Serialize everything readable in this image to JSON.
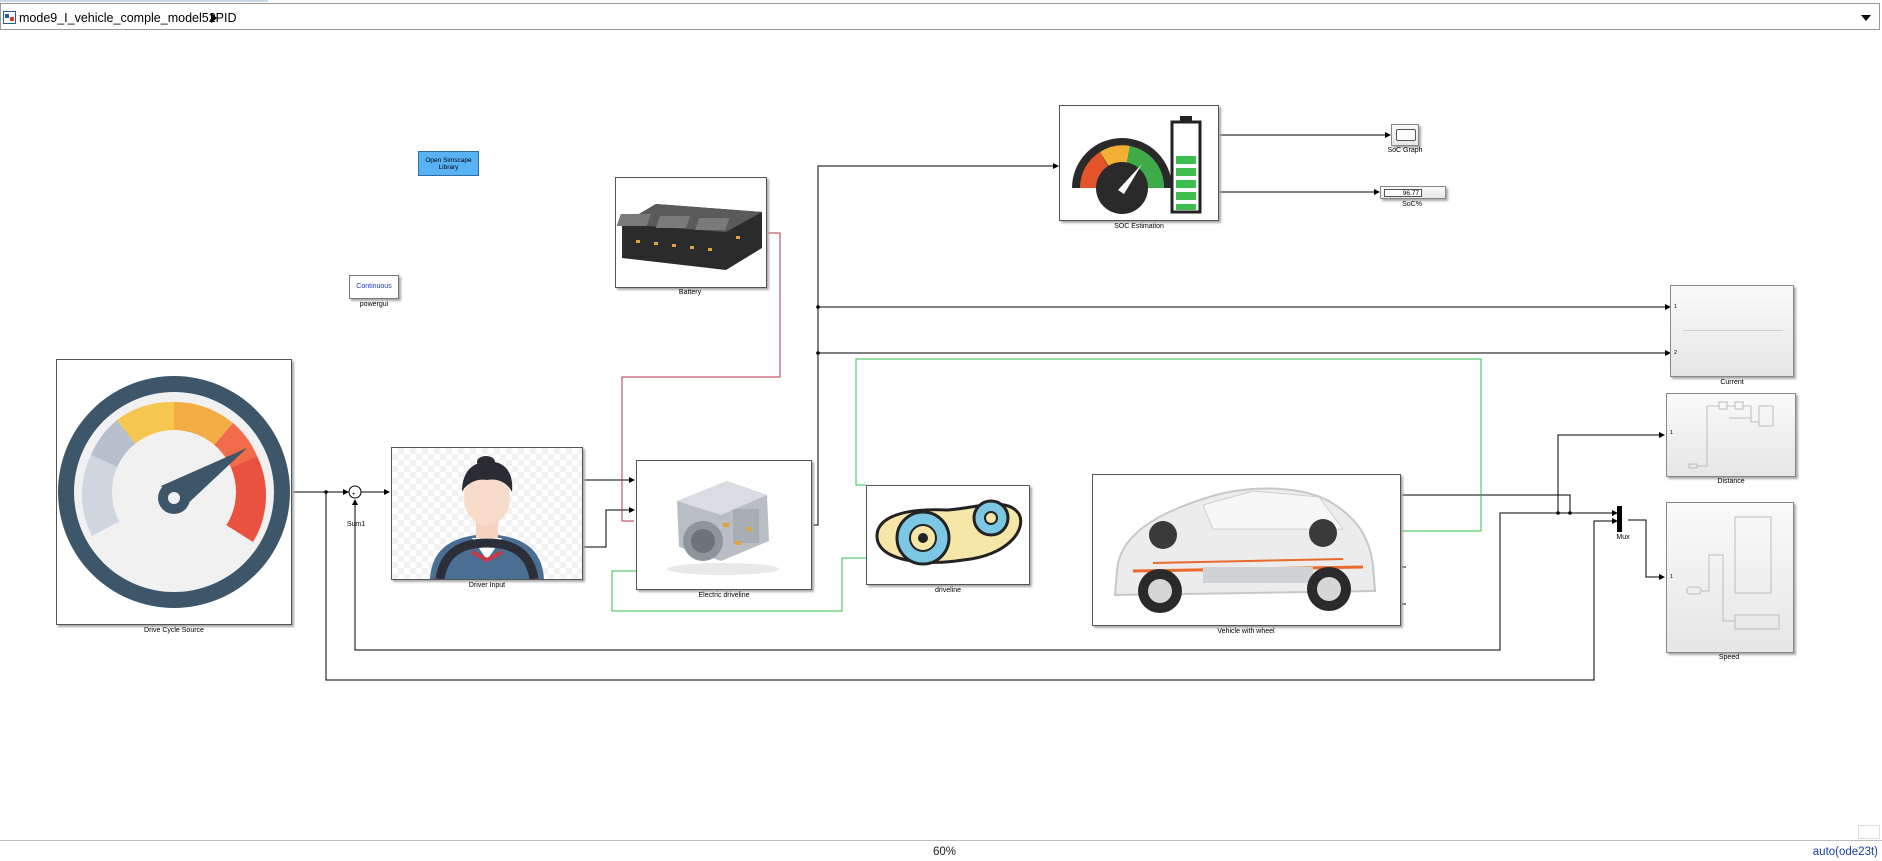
{
  "window": {
    "breadcrumb": "mode9_I_vehicle_comple_model52PID"
  },
  "canvas": {
    "library_button": "Open Simscape Library",
    "powergui_block_text": "Continuous",
    "blocks": {
      "drive_cycle": "Drive Cycle Source",
      "sum": "Sum1",
      "driver": "Driver Input",
      "battery": "Battery",
      "edrive": "Electric driveline",
      "driveline": "driveline",
      "vehicle": "Vehicle with wheel",
      "soc_est": "SOC Estimation",
      "soc_graph": "SoC Graph",
      "soc_pct": "SoC%",
      "soc_value": "96.77",
      "current": "Current",
      "distance": "Distance",
      "speed": "Speed",
      "mux": "Mux",
      "powergui": "powergui"
    },
    "port_labels": {
      "current_in1": "1",
      "current_in2": "2",
      "distance_in": "1",
      "speed_in": "1"
    },
    "colors": {
      "wire_signal": "#000000",
      "wire_electrical": "#b4304a",
      "wire_mechanical": "#2fbf4a",
      "library_button": "#58b3f5"
    }
  },
  "statusbar": {
    "zoom": "60%",
    "solver": "auto(ode23t)"
  }
}
